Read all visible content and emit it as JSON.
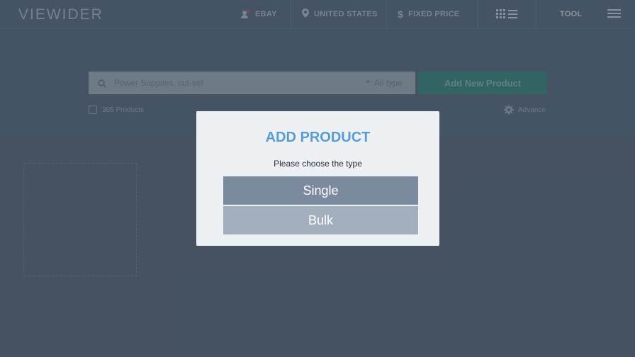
{
  "header": {
    "logo": "VIEWIDER",
    "nav": {
      "marketplace": "EBAY",
      "location": "UNITED STATES",
      "price_type": "FIXED PRICE",
      "tool": "TOOL"
    }
  },
  "search": {
    "placeholder": "Power Supplies, cut-sel",
    "type_select": "All type",
    "add_button": "Add New Product"
  },
  "toolbar": {
    "product_count": "305 Products",
    "advance": "Advance"
  },
  "modal": {
    "title": "ADD PRODUCT",
    "subtitle": "Please choose the type",
    "options": [
      "Single",
      "Bulk"
    ]
  },
  "colors": {
    "accent": "#5a9bd3",
    "add_button": "#3f8f86",
    "single_button": "#7c8aa0",
    "bulk_button": "#a3afbc"
  }
}
